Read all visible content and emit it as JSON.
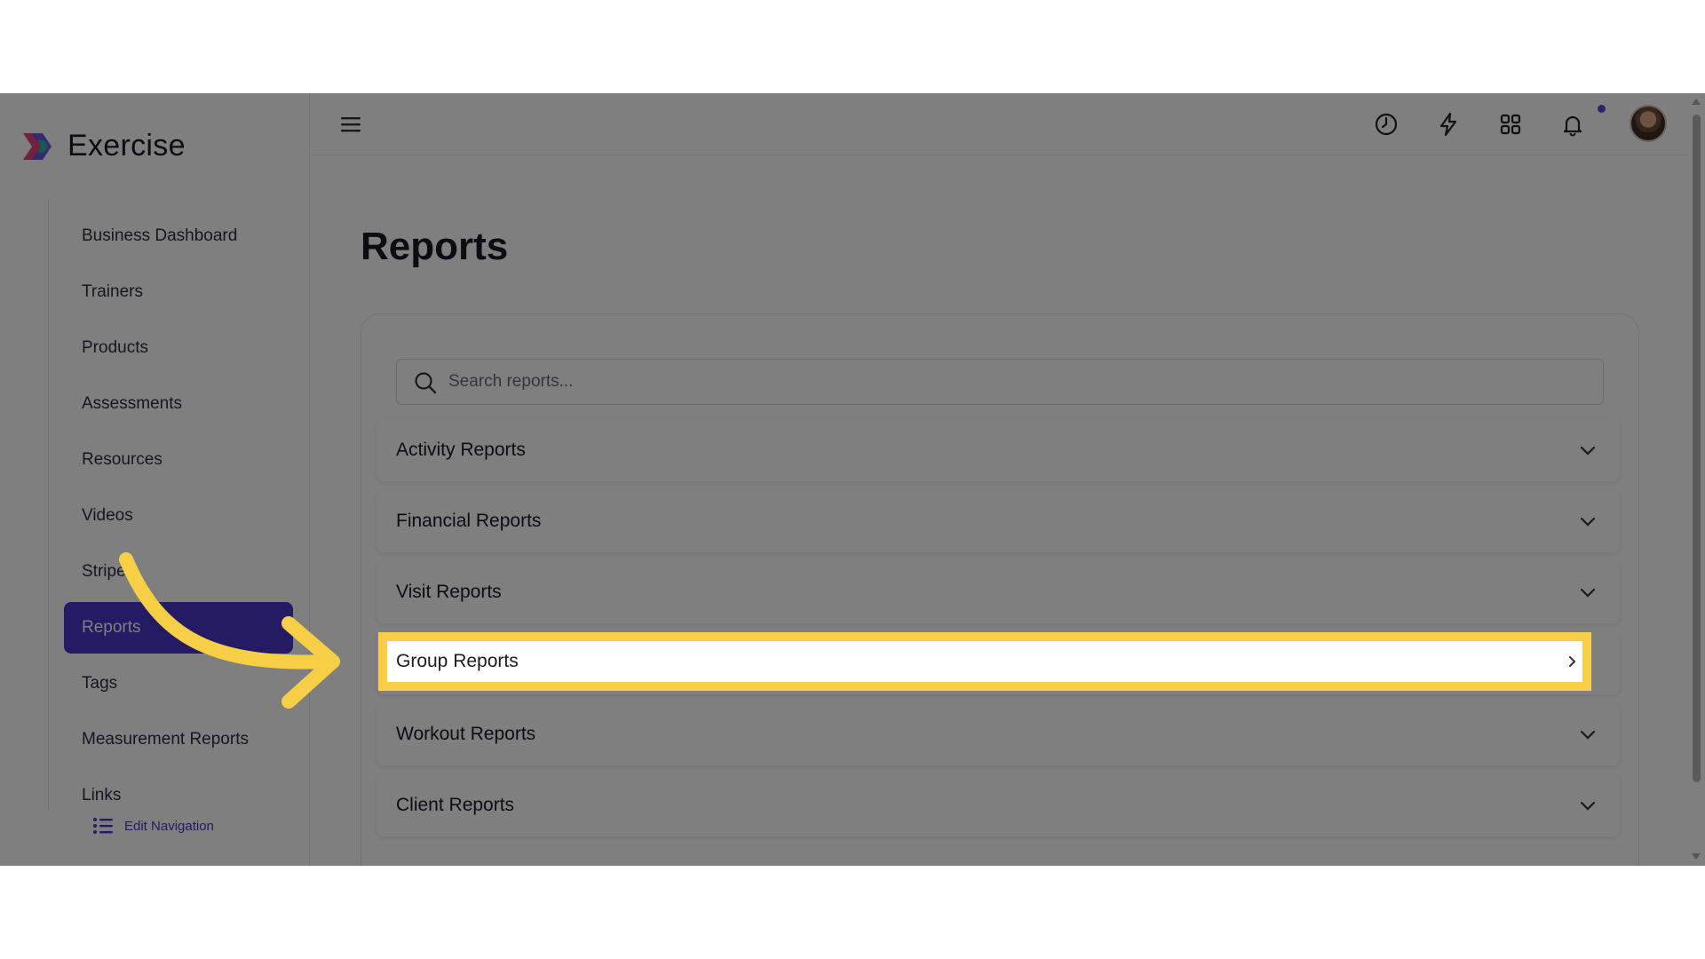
{
  "app": {
    "name": "Exercise"
  },
  "sidebar": {
    "items": [
      {
        "label": "Business Dashboard"
      },
      {
        "label": "Trainers"
      },
      {
        "label": "Products"
      },
      {
        "label": "Assessments"
      },
      {
        "label": "Resources"
      },
      {
        "label": "Videos"
      },
      {
        "label": "Stripe"
      },
      {
        "label": "Reports",
        "active": true
      },
      {
        "label": "Tags"
      },
      {
        "label": "Measurement Reports"
      },
      {
        "label": "Links"
      }
    ],
    "edit_navigation": "Edit Navigation"
  },
  "header": {
    "icons": [
      "menu-icon",
      "clock-icon",
      "lightning-icon",
      "apps-grid-icon",
      "bell-icon",
      "user-avatar"
    ]
  },
  "main": {
    "title": "Reports",
    "search_placeholder": "Search reports...",
    "sections": [
      {
        "label": "Activity Reports"
      },
      {
        "label": "Financial Reports"
      },
      {
        "label": "Visit Reports"
      },
      {
        "label": "Group Reports",
        "highlighted": true
      },
      {
        "label": "Workout Reports"
      },
      {
        "label": "Client Reports"
      }
    ]
  },
  "colors": {
    "accent": "#4a35c9",
    "highlight": "#f7cf46",
    "overlay": "rgba(0,0,0,0.5)"
  }
}
